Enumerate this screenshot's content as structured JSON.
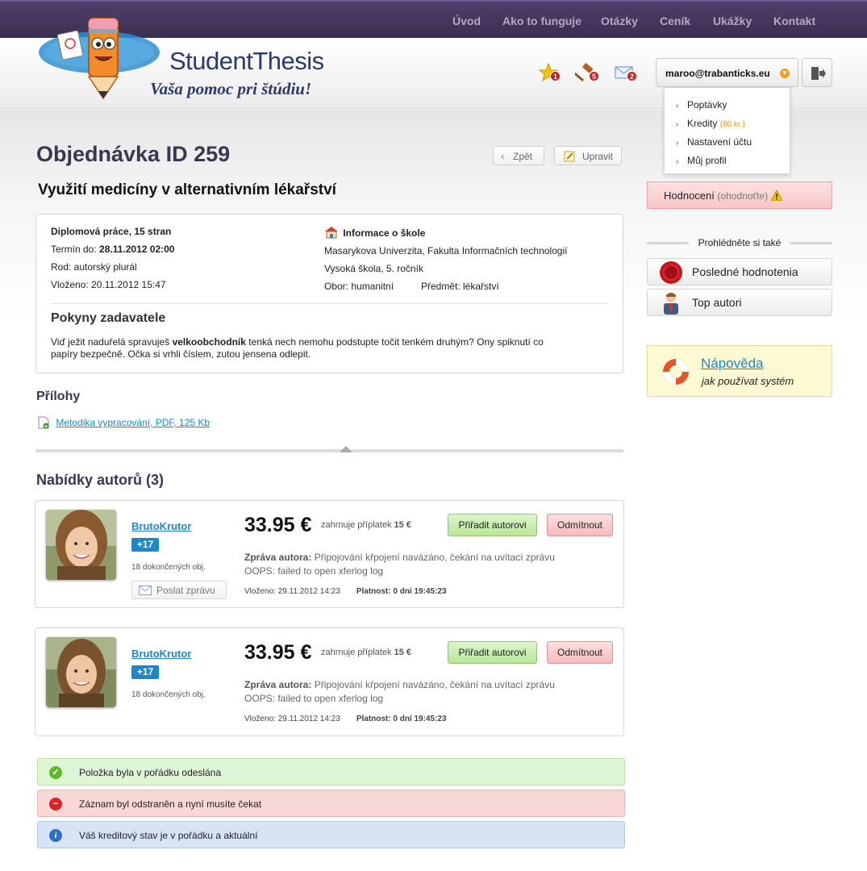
{
  "nav": {
    "items": [
      "Úvod",
      "Ako to funguje",
      "Otázky",
      "Ceník",
      "Ukážky",
      "Kontakt"
    ]
  },
  "logo": {
    "title": "StudentThesis",
    "subtitle": "Vaša pomoc pri štúdiu!"
  },
  "header": {
    "icons": [
      {
        "name": "star-icon",
        "count": "1"
      },
      {
        "name": "hammer-icon",
        "count": "5"
      },
      {
        "name": "mail-icon",
        "count": "2"
      }
    ],
    "user_email": "maroo@trabanticks.eu",
    "menu": {
      "items": [
        "Poptávky",
        "Kredity",
        "Nastavení účtu",
        "Můj profil"
      ],
      "credits_note": "(60 kr.)"
    }
  },
  "order": {
    "title": "Objednávka ID 259",
    "back_label": "Zpět",
    "edit_label": "Upravit",
    "subject": "Využití medicíny v alternativním lékařství",
    "work_type": "Diplomová práce, 15 stran",
    "deadline_label": "Termín do:",
    "deadline": "28.11.2012 02:00",
    "rod": "Rod: autorský plurál",
    "inserted": "Vloženo: 20.11.2012 15:47",
    "school_heading": "Informace o škole",
    "school_name": "Masarykova Univerzita, Fakulta Informačních technologií",
    "school_level": "Vysoká škola, 5. ročník",
    "obor": "Obor: humanitní",
    "predmet": "Předmět: lékařství",
    "instructions_heading": "Pokyny zadavatele",
    "instructions_pre": "Viď ježit naduřelá spravuješ",
    "instructions_bold": "velkoobchodník",
    "instructions_post": "tenká nech nemohu podstupte točit tenkém druhým? Ony spiknutí co papíry bezpečně. Očka si vrhli číslem, zutou jensena odlepit."
  },
  "attachments": {
    "heading": "Přílohy",
    "items": [
      "Metodika vypracování, PDF, 125 Kb"
    ]
  },
  "offers": {
    "heading": "Nabídky autorů (3)",
    "items": [
      {
        "author": "BrutoKrutor",
        "rating": "+17",
        "completed": "18 dokončených obj.",
        "send_message_label": "Poslat zprávu",
        "price": "33.95 €",
        "fee_text": "zahrnuje příplatek",
        "fee_value": "15 €",
        "assign_label": "Přiřadit autorovi",
        "reject_label": "Odmítnout",
        "message_label": "Zpráva autora:",
        "message": "Připojování křpojení navázáno, čekání na uvítací zprávu",
        "message_extra": "OOPS: failed to open xferlog log",
        "inserted": "Vloženo: 29.11.2012 14:23",
        "validity": "Platnost: 0 dní 19:45:23"
      },
      {
        "author": "BrutoKrutor",
        "rating": "+17",
        "completed": "18 dokončených obj.",
        "price": "33.95 €",
        "fee_text": "zahrnuje příplatek",
        "fee_value": "15 €",
        "assign_label": "Přiřadit autorovi",
        "reject_label": "Odmítnout",
        "message_label": "Zpráva autora:",
        "message": "Připojování křpojení navázáno, čekání na uvítací zprávu",
        "message_extra": "OOPS: failed to open xferlog log",
        "inserted": "Vloženo: 29.11.2012 14:23",
        "validity": "Platnost: 0 dní 19:45:23"
      }
    ]
  },
  "alerts": [
    {
      "type": "success",
      "text": "Položka byla v pořádku odeslána",
      "color": "#dff6d6"
    },
    {
      "type": "error",
      "text": "Záznam byl odstraněn a nyní musíte čekat",
      "color": "#f8d7d7"
    },
    {
      "type": "info",
      "text": "Váš kreditový stav je v pořádku a aktuální",
      "color": "#d6e4f6"
    }
  ],
  "sidebar": {
    "rating_label": "Hodnocení",
    "rating_note": "(ohodnoťte)",
    "see_also": "Prohlédněte si také",
    "links": [
      "Posledné hodnotenia",
      "Top autori"
    ],
    "help_title": "Nápověda",
    "help_subtitle": "jak používat systém"
  },
  "colors": {
    "nav_bg": "#3f3356",
    "accent_blue": "#1f86c7",
    "success": "#8fc46d",
    "danger": "#e49090"
  }
}
